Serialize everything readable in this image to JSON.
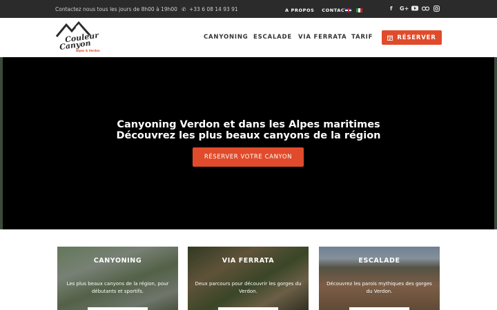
{
  "topbar": {
    "contact_text": "Contactez nous tous les jours de 8h00 à 19h00",
    "phone": "+33 6 08 14 93 91",
    "links": [
      "A PROPOS",
      "CONTACT"
    ],
    "languages": [
      "english-flag",
      "italian-flag"
    ],
    "social_icons": [
      "facebook-icon",
      "google-plus-icon",
      "youtube-icon",
      "tripadvisor-icon",
      "instagram-icon"
    ]
  },
  "header": {
    "logo": {
      "line1": "Couleur",
      "line2": "Canyon",
      "tagline": "Alpes & Verdon"
    },
    "nav": [
      "CANYONING",
      "ESCALADE",
      "VIA FERRATA",
      "TARIF"
    ],
    "reserve_label": "RÉSERVER"
  },
  "hero": {
    "title_line1": "Canyoning Verdon et dans les Alpes maritimes",
    "title_line2": "Découvrez les plus beaux canyons de la région",
    "button_label": "RÉSERVER VOTRE CANYON"
  },
  "cards": [
    {
      "title": "CANYONING",
      "text": "Les plus beaux canyons de la région, pour débutants et sportifs."
    },
    {
      "title": "VIA FERRATA",
      "text": "Deux parcours pour découvrir les gorges du Verdon."
    },
    {
      "title": "ESCALADE",
      "text": "Découvrez les parois mythiques des gorges du Verdon."
    }
  ],
  "colors": {
    "accent": "#e04b2b",
    "topbar": "#2b2b2b",
    "hero": "#000000"
  }
}
